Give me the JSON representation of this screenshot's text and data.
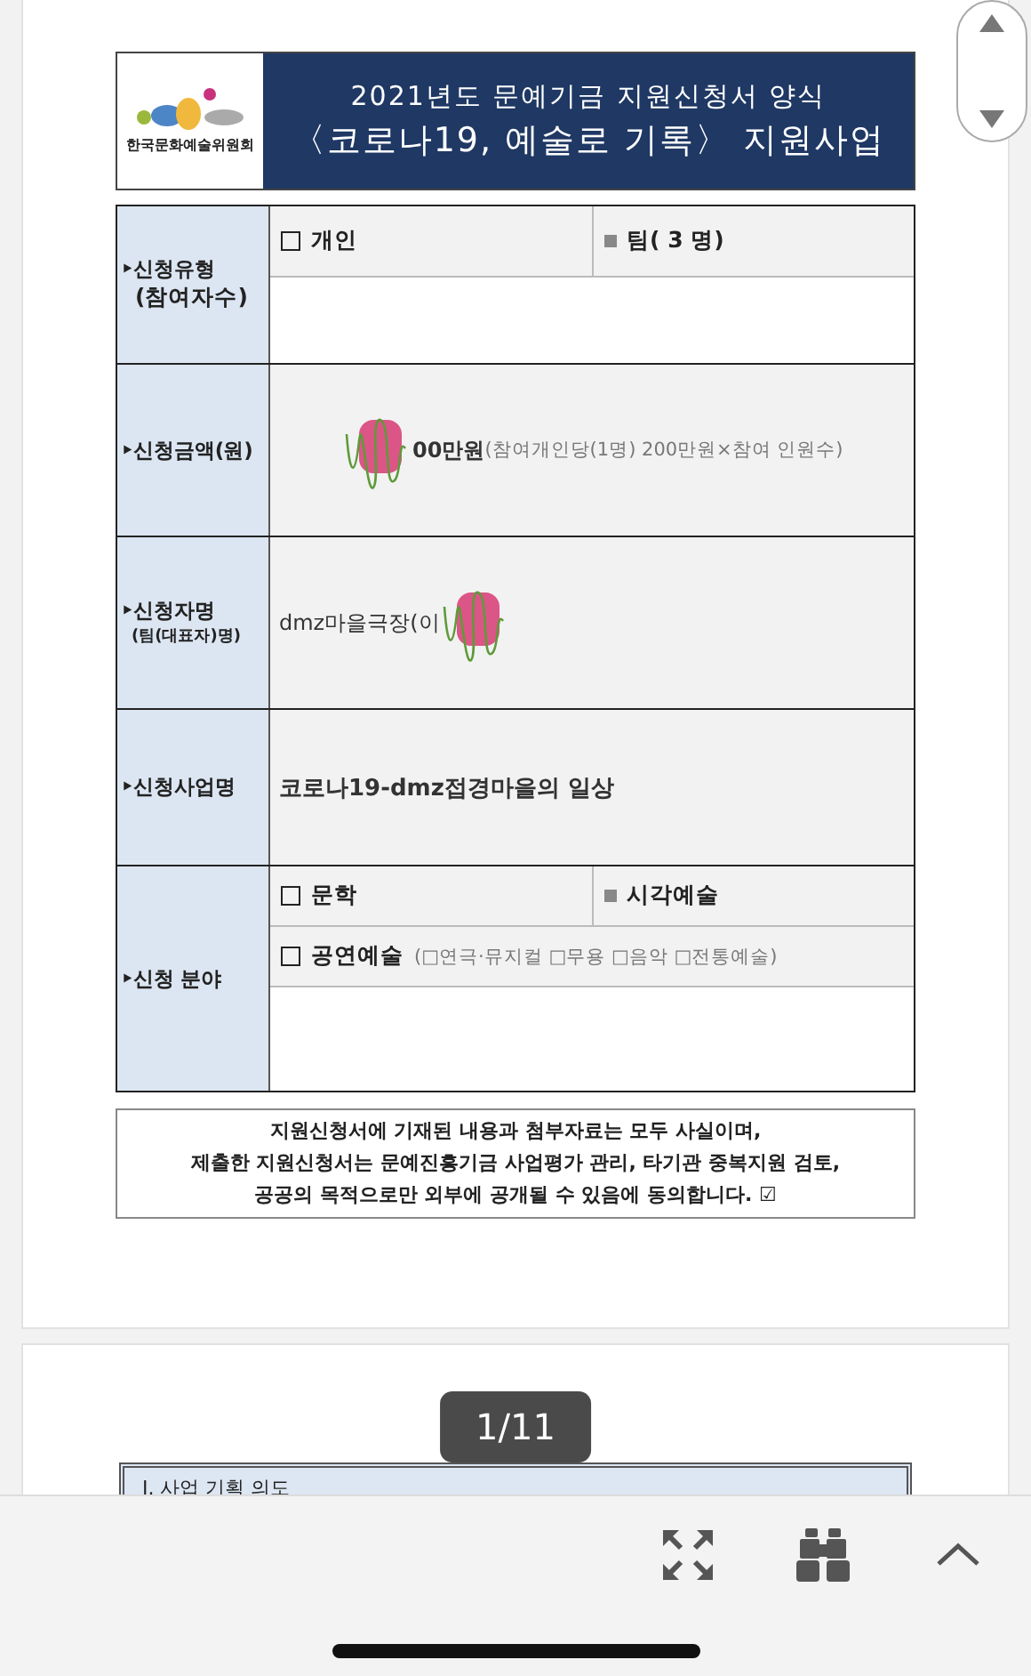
{
  "header": {
    "logo_text": "한국문화예술위원회",
    "title_lines": [
      "2021년도 문예기금 지원신청서 양식",
      "〈코로나19, 예술로 기록〉 지원사업"
    ]
  },
  "form_rows": [
    {
      "kind": "options",
      "label": "‣신청유형",
      "sublabel": "(참여자수)",
      "options": [
        {
          "label": "개인",
          "checked": false
        },
        {
          "label": "팀(   3 명)",
          "checked": true
        }
      ]
    },
    {
      "kind": "amount",
      "label": "‣신청금액(원)",
      "value": "00만원",
      "note": "(참여개인당(1명) 200만원×참여 인원수)"
    },
    {
      "kind": "name",
      "label": "‣신청자명",
      "sublabel": "(팀(대표자)명)",
      "value": "dmz마을극장(이"
    },
    {
      "kind": "text",
      "label": "‣신청사업명",
      "value": "코로나19-dmz접경마을의 일상"
    },
    {
      "kind": "fields",
      "label": "‣신청 분야",
      "options": [
        {
          "label": "문학",
          "checked": false
        },
        {
          "label": "시각예술",
          "checked": true
        }
      ],
      "extra": {
        "label": "공연예술",
        "checked": false,
        "note": "(□연극·뮤지컬 □무용 □음악 □전통예술)"
      }
    }
  ],
  "agreement": [
    "지원신청서에 기재된 내용과 첨부자료는 모두 사실이며,",
    "제출한 지원신청서는 문예진흥기금 사업평가 관리, 타기관 중복지원 검토,",
    "공공의 목적으로만 외부에 공개될 수 있음에 동의합니다. ☑"
  ],
  "page_indicator": "1/11",
  "next_page_heading": "Ⅰ. 사업 기획 의도"
}
